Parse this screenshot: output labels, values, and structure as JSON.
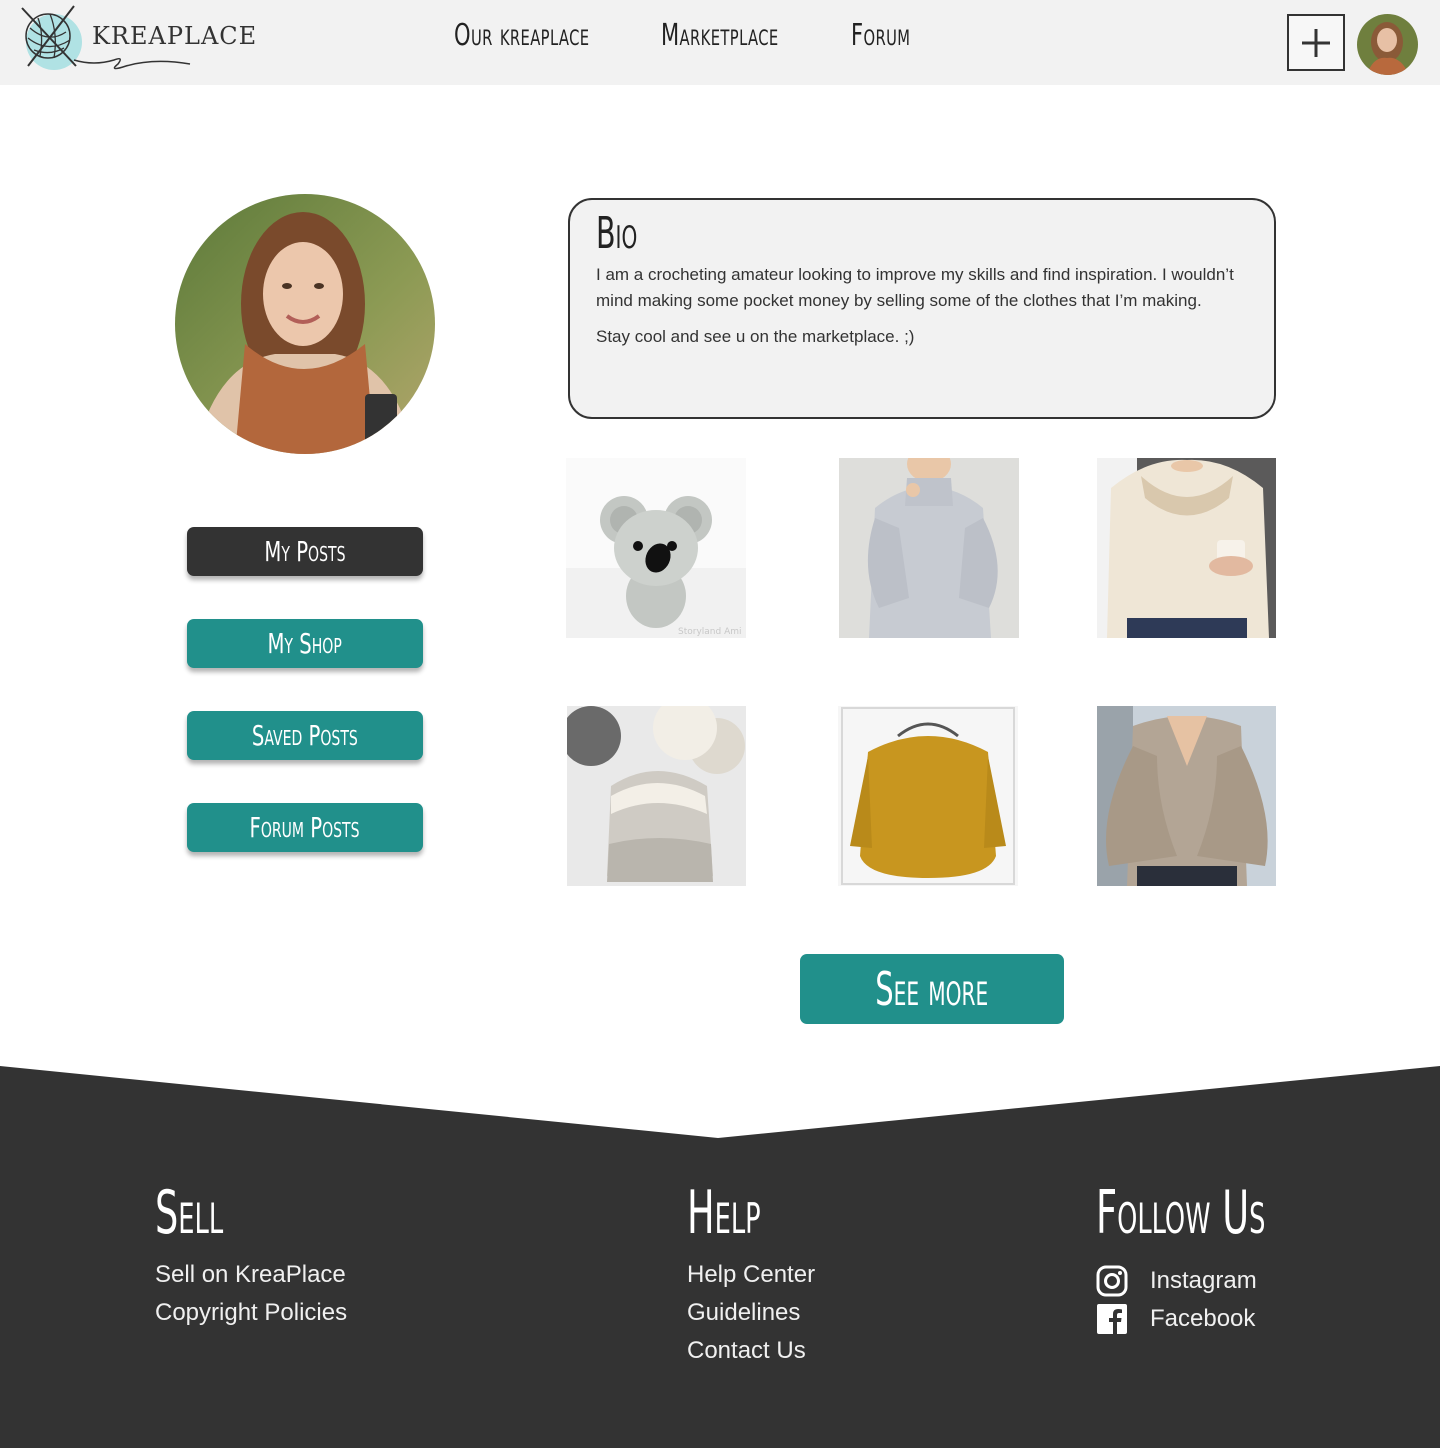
{
  "brand": {
    "name": "KREAPLACE"
  },
  "nav": {
    "items": [
      "Our kreaplace",
      "Marketplace",
      "Forum"
    ]
  },
  "header": {
    "add_label": "+"
  },
  "sidebar": {
    "buttons": [
      "My Posts",
      "My Shop",
      "Saved Posts",
      "Forum Posts"
    ],
    "active": "My Posts"
  },
  "bio": {
    "title": "Bio",
    "paragraphs": [
      "I am a crocheting amateur looking to improve my skills and find inspiration. I wouldn’t mind making some pocket money by selling some of the clothes that I’m making.",
      "Stay cool and see u on the marketplace. ;)"
    ]
  },
  "posts": [
    {
      "subject": "crochet koala amigurumi",
      "caption": "Storyland Ami"
    },
    {
      "subject": "grey chunky sweater"
    },
    {
      "subject": "cream yoke sweater"
    },
    {
      "subject": "striped pompom beanie"
    },
    {
      "subject": "mustard crochet sweater"
    },
    {
      "subject": "taupe bell-sleeve top"
    }
  ],
  "see_more_label": "See more",
  "footer": {
    "sell": {
      "title": "Sell",
      "links": [
        "Sell on KreaPlace",
        "Copyright Policies"
      ]
    },
    "help": {
      "title": "Help",
      "links": [
        "Help Center",
        "Guidelines",
        "Contact Us"
      ]
    },
    "follow": {
      "title": "Follow Us",
      "links": [
        "Instagram",
        "Facebook"
      ]
    }
  },
  "colors": {
    "teal": "#21908b",
    "dark": "#333333",
    "header_bg": "#f2f2f2"
  }
}
